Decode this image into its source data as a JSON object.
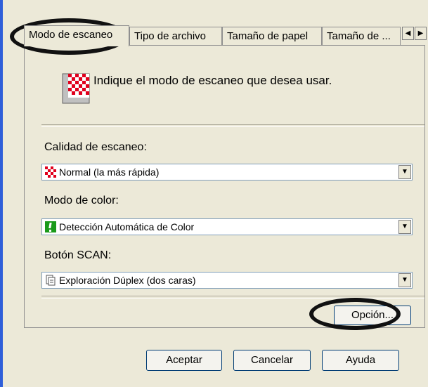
{
  "tabs": [
    {
      "label": "Modo de escaneo"
    },
    {
      "label": "Tipo de archivo"
    },
    {
      "label": "Tamaño de papel"
    },
    {
      "label": "Tamaño de ..."
    }
  ],
  "header": {
    "text": "Indique el modo de escaneo que desea usar.",
    "icon": "checkerboard-icon"
  },
  "fields": {
    "quality": {
      "label": "Calidad de escaneo:",
      "value": "Normal (la más rápida)",
      "icon": "checkerboard-icon"
    },
    "color": {
      "label": "Modo de color:",
      "value": "Detección Automática de Color",
      "icon": "exclamation-icon"
    },
    "scan_button": {
      "label": "Botón SCAN:",
      "value": "Exploración Dúplex (dos caras)",
      "icon": "duplex-document-icon"
    }
  },
  "buttons": {
    "option": "Opción...",
    "accept": "Aceptar",
    "cancel": "Cancelar",
    "help": "Ayuda"
  },
  "colors": {
    "accent": "#2f5fd9",
    "annotation": "#111111",
    "checker_red": "#e0001c"
  }
}
